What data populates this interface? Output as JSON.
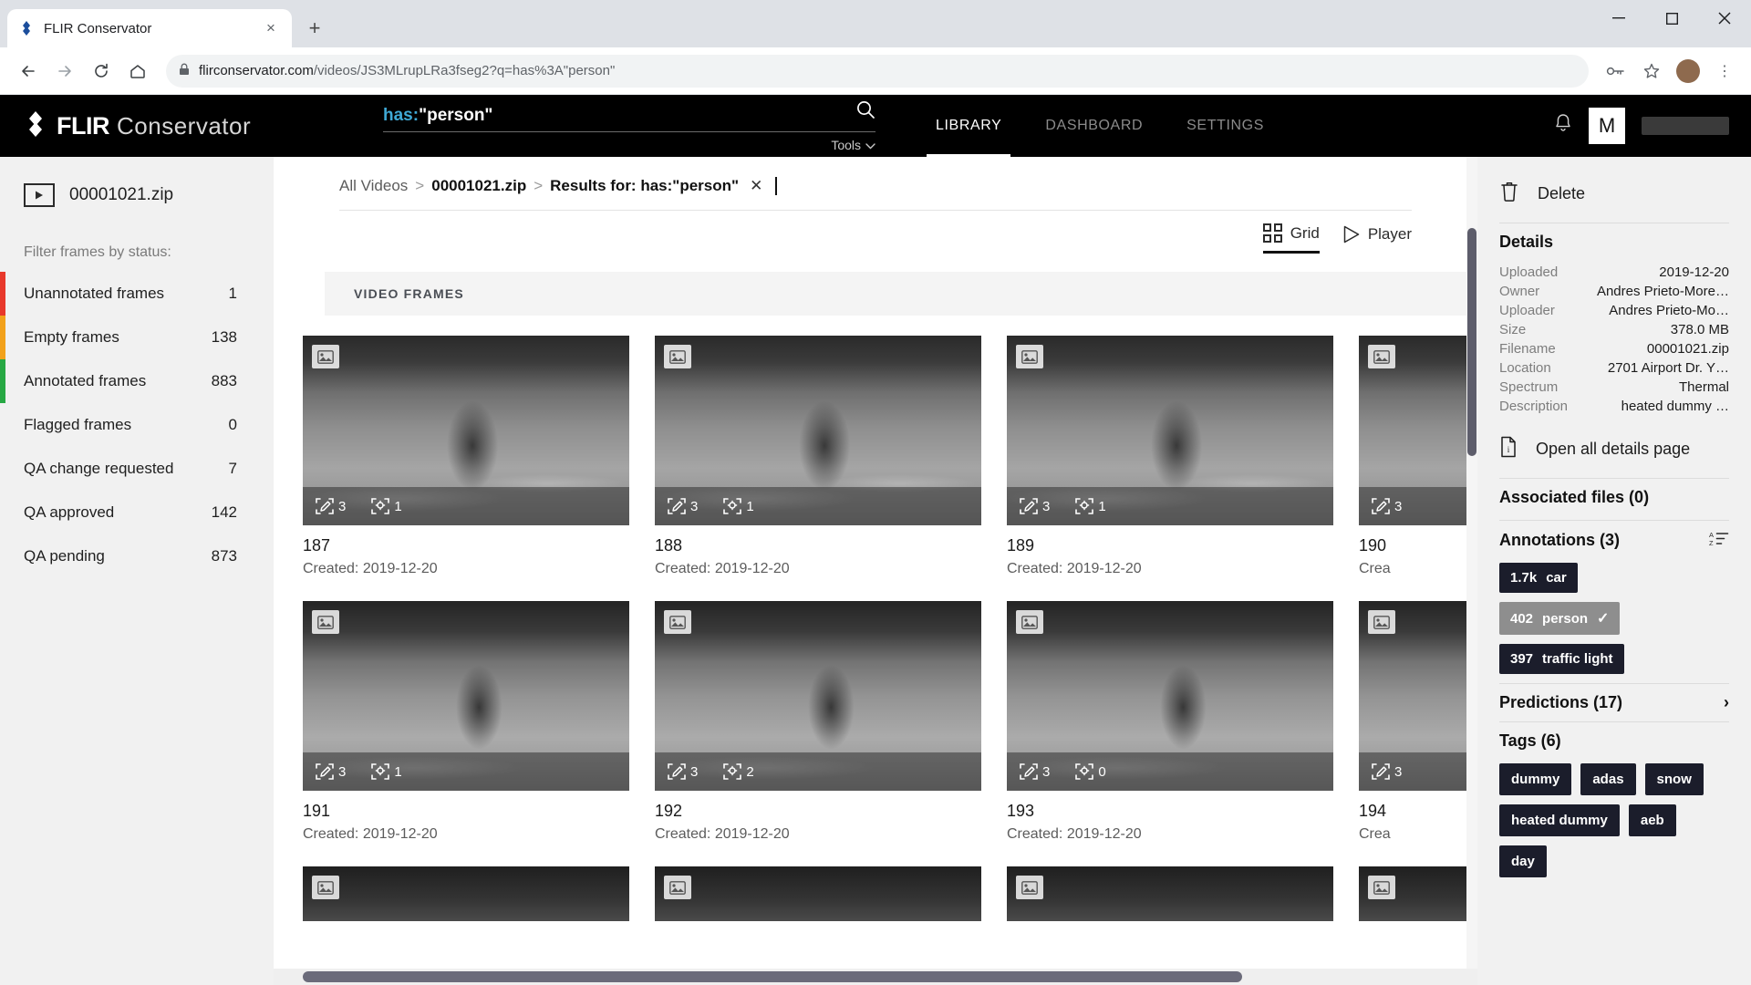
{
  "browser": {
    "tab": {
      "title": "FLIR Conservator",
      "favicon": "flir-diamond-icon",
      "close": "×"
    },
    "new_tab": "+",
    "window_controls": {
      "minimize": "—",
      "maximize": "☐",
      "close": "✕"
    },
    "nav": {
      "back": "←",
      "forward": "→",
      "reload": "⟳",
      "home": "⌂"
    },
    "omnibox": {
      "lock": "🔒",
      "host": "flirconservator.com",
      "path": "/videos/JS3MLrupLRa3fseg2?q=has%3A\"person\"",
      "full_url": "flirconservator.com/videos/JS3MLrupLRa3fseg2?q=has%3A\"person\""
    },
    "toolbar_right": {
      "key_icon": "⚷",
      "star_icon": "☆",
      "menu_icon": "⋮",
      "avatar_letter": ""
    }
  },
  "header": {
    "brand_flir": "FLIR",
    "brand_product": "Conservator",
    "search": {
      "prefix": "has:",
      "query": "\"person\"",
      "value": "has:\"person\"",
      "placeholder": "Search"
    },
    "tools_label": "Tools",
    "nav_items": [
      {
        "label": "LIBRARY",
        "active": true
      },
      {
        "label": "DASHBOARD",
        "active": false
      },
      {
        "label": "SETTINGS",
        "active": false
      }
    ],
    "user_initial": "M"
  },
  "sidebar": {
    "file_name": "00001021.zip",
    "filter_label": "Filter frames by status:",
    "items": [
      {
        "label": "Unannotated frames",
        "count": "1",
        "color": "#e8382b"
      },
      {
        "label": "Empty frames",
        "count": "138",
        "color": "#f2a11b"
      },
      {
        "label": "Annotated frames",
        "count": "883",
        "color": "#27a844"
      },
      {
        "label": "Flagged frames",
        "count": "0",
        "color": ""
      },
      {
        "label": "QA change requested",
        "count": "7",
        "color": ""
      },
      {
        "label": "QA approved",
        "count": "142",
        "color": ""
      },
      {
        "label": "QA pending",
        "count": "873",
        "color": ""
      }
    ]
  },
  "breadcrumb": {
    "root": "All Videos",
    "sep": ">",
    "file": "00001021.zip",
    "results": "Results for: has:\"person\"",
    "clear": "✕"
  },
  "view_toggle": {
    "grid_label": "Grid",
    "player_label": "Player",
    "active": "Grid"
  },
  "frames_panel": {
    "section_title": "VIDEO FRAMES",
    "rows": [
      [
        {
          "id": "187",
          "created": "Created: 2019-12-20",
          "edits": "3",
          "objects": "1"
        },
        {
          "id": "188",
          "created": "Created: 2019-12-20",
          "edits": "3",
          "objects": "1"
        },
        {
          "id": "189",
          "created": "Created: 2019-12-20",
          "edits": "3",
          "objects": "1"
        },
        {
          "id": "190",
          "created": "Crea",
          "edits": "3",
          "objects": ""
        }
      ],
      [
        {
          "id": "191",
          "created": "Created: 2019-12-20",
          "edits": "3",
          "objects": "1"
        },
        {
          "id": "192",
          "created": "Created: 2019-12-20",
          "edits": "3",
          "objects": "2"
        },
        {
          "id": "193",
          "created": "Created: 2019-12-20",
          "edits": "3",
          "objects": "0"
        },
        {
          "id": "194",
          "created": "Crea",
          "edits": "3",
          "objects": ""
        }
      ]
    ]
  },
  "details": {
    "delete_label": "Delete",
    "title": "Details",
    "rows": [
      {
        "key": "Uploaded",
        "value": "2019-12-20"
      },
      {
        "key": "Owner",
        "value": "Andres Prieto-More…"
      },
      {
        "key": "Uploader",
        "value": "Andres Prieto-Mo…"
      },
      {
        "key": "Size",
        "value": "378.0 MB"
      },
      {
        "key": "Filename",
        "value": "00001021.zip"
      },
      {
        "key": "Location",
        "value": "2701 Airport Dr. Y…"
      },
      {
        "key": "Spectrum",
        "value": "Thermal"
      },
      {
        "key": "Description",
        "value": "heated dummy …"
      }
    ],
    "open_all_label": "Open all details page",
    "associated_files": "Associated files (0)",
    "annotations_title": "Annotations (3)",
    "sort_icon": "sort-az-icon",
    "annotations": [
      {
        "count": "1.7k",
        "label": "car",
        "selected": false,
        "check": ""
      },
      {
        "count": "402",
        "label": "person",
        "selected": true,
        "check": "✓"
      },
      {
        "count": "397",
        "label": "traffic light",
        "selected": false,
        "check": ""
      }
    ],
    "predictions": "Predictions (17)",
    "predictions_chevron": "›",
    "tags_title": "Tags (6)",
    "tags": [
      "dummy",
      "adas",
      "snow",
      "heated dummy",
      "aeb",
      "day"
    ]
  },
  "colors": {
    "app_header_bg": "#000000",
    "panel_bg": "#f1f1f1",
    "accent_search": "#3fa9d6",
    "chip_bg": "#1b1d2b",
    "chip_selected_bg": "#8e8e8e"
  }
}
